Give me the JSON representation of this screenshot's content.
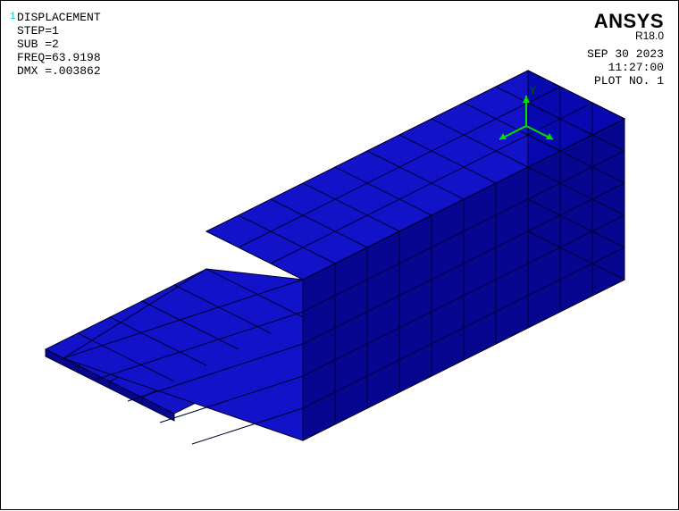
{
  "header": {
    "title": "DISPLACEMENT",
    "step_label": "STEP=1",
    "sub_label": "SUB =2",
    "freq_label": "FREQ=63.9198",
    "dmx_label": "DMX =.003862"
  },
  "brand": {
    "name": "ANSYS",
    "version": "R18.0"
  },
  "meta": {
    "date": "SEP 30 2023",
    "time": "11:27:00",
    "plot_label": "PLOT NO.   1"
  },
  "triad": {
    "y": "Y"
  },
  "model": {
    "fill": "#0808b0",
    "edge": "#000030"
  }
}
